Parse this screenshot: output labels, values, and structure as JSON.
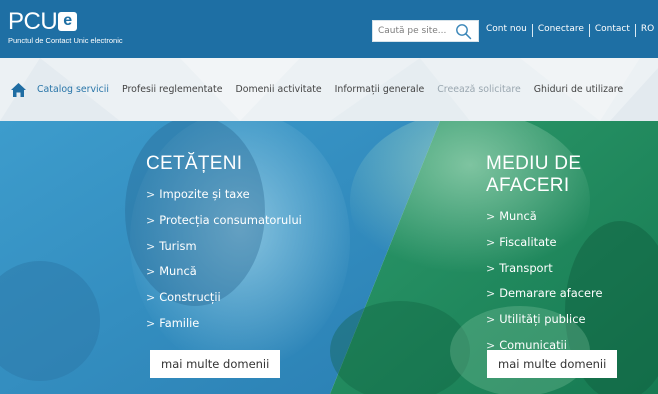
{
  "header": {
    "logo": "PCU",
    "logo_badge": "e",
    "subtitle": "Punctul de Contact Unic electronic",
    "search_placeholder": "Caută pe site...",
    "links": [
      "Cont nou",
      "Conectare",
      "Contact",
      "RO"
    ]
  },
  "nav": {
    "items": [
      {
        "label": "Catalog servicii",
        "state": "active"
      },
      {
        "label": "Profesii reglementate",
        "state": "normal"
      },
      {
        "label": "Domenii activitate",
        "state": "normal"
      },
      {
        "label": "Informații generale",
        "state": "normal"
      },
      {
        "label": "Creează solicitare",
        "state": "disabled"
      },
      {
        "label": "Ghiduri de utilizare",
        "state": "normal"
      }
    ]
  },
  "citizens": {
    "title": "CETĂȚENI",
    "items": [
      "Impozite și taxe",
      "Protecția consumatorului",
      "Turism",
      "Muncă",
      "Construcții",
      "Familie"
    ],
    "more": "mai multe domenii"
  },
  "business": {
    "title": "MEDIU DE AFACERI",
    "items": [
      "Muncă",
      "Fiscalitate",
      "Transport",
      "Demarare afacere",
      "Utilități publice",
      "Comunicații"
    ],
    "more": "mai multe domenii"
  },
  "colors": {
    "header_bg": "#1e6fa4",
    "citizens_overlay": "#2e8cc0",
    "business_overlay": "#1c8a5f",
    "nav_active": "#2a76a9"
  },
  "icons": {
    "home": "home-icon",
    "search": "search-icon",
    "chevron": "chevron-right-icon"
  }
}
